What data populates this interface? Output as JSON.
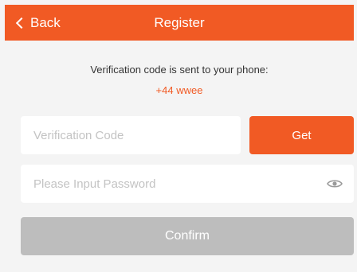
{
  "nav": {
    "back_label": "Back",
    "title": "Register"
  },
  "info": {
    "message": "Verification code is sent to your phone:",
    "phone": "+44 wwee"
  },
  "form": {
    "code_placeholder": "Verification Code",
    "code_value": "",
    "get_label": "Get",
    "password_placeholder": "Please Input Password",
    "password_value": "",
    "visibility_icon": "eye-icon",
    "confirm_label": "Confirm"
  },
  "colors": {
    "accent": "#f15a24",
    "background": "#f4f4f4",
    "disabled_button": "#bdbdbd"
  }
}
